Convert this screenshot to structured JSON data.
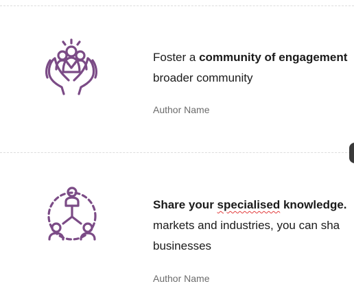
{
  "colors": {
    "accent_purple": "#7b4b86",
    "divider": "#dcdcdc",
    "author_text": "#6b6b6b"
  },
  "cards": [
    {
      "icon": "community-hands-icon",
      "text_prefix": "Foster a ",
      "text_bold": "community of engagement",
      "text_line2": "broader community",
      "author": "Author Name"
    },
    {
      "icon": "network-person-icon",
      "text_bold_a": "Share your ",
      "text_bold_misspelled": "specialised",
      "text_bold_b": " knowledge.",
      "text_line2": "markets and industries, you can sha",
      "text_line3": "businesses",
      "author": "Author Name"
    }
  ]
}
